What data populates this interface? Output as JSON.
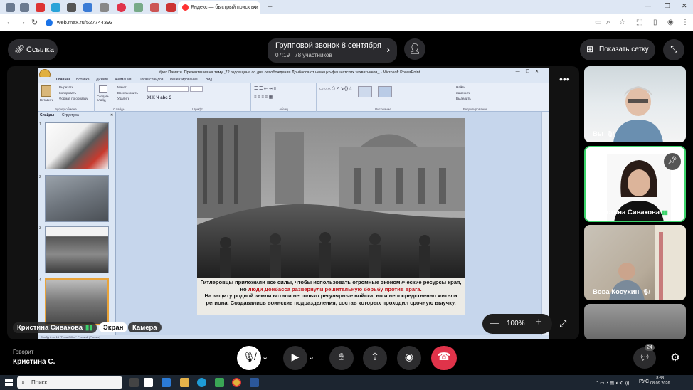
{
  "browser": {
    "active_tab_title": "Яндекс — быстрый поиск в и",
    "url": "web.max.ru/527744393",
    "tab_icons": [
      "tab-icon",
      "tab-icon",
      "tab-icon",
      "tab-icon",
      "tab-icon",
      "tab-icon",
      "tab-icon",
      "tab-icon",
      "tab-icon",
      "tab-icon",
      "tab-icon"
    ]
  },
  "call": {
    "link_label": "Ссылка",
    "title": "Групповой звонок 8 сентября",
    "duration": "07:19",
    "participants_count": "78 участников",
    "grid_label": "Показать сетку"
  },
  "powerpoint": {
    "window_title": "Урок Памяти. Презентация на тему „72 годовщина со дня освобождения Донбасса от немецко-фашистских захватчиков_ - Microsoft PowerPoint",
    "ribbon_tabs": [
      "Главная",
      "Вставка",
      "Дизайн",
      "Анимация",
      "Показ слайдов",
      "Рецензирование",
      "Вид"
    ],
    "ribbon_groups": [
      "Буфер обмена",
      "Слайды",
      "Шрифт",
      "Абзац",
      "Рисование",
      "Редактирование"
    ],
    "clipboard_items": [
      "Вырезать",
      "Копировать",
      "Формат по образцу"
    ],
    "paste_label": "Вставить",
    "slides_items": [
      "Макет",
      "Восстановить",
      "Удалить"
    ],
    "new_slide_label": "Создать слайд",
    "editing_items": [
      "Найти",
      "Заменить",
      "Выделить"
    ],
    "panel_tabs": [
      "Слайды",
      "Структура"
    ],
    "slide_numbers": [
      "1",
      "2",
      "3",
      "4"
    ],
    "caption_line1": "Гитлеровцы приложили все силы, чтобы использовать огромные экономические ресурсы края,",
    "caption_line2_pre": "но ",
    "caption_line2_red": "люди Донбасса развернули решительную борьбу против врага.",
    "caption_line3": "На защиту родной земли встали не только регулярные войска, но и непосредственно жители",
    "caption_line4": "региона. Создавались  воинские подразделения, состав которых проходил срочную выучку.",
    "status_text": "Слайд 8 из 16    \"Тема Office\"    Русский (Россия)",
    "notes_fragment": "у"
  },
  "share_overlay": {
    "presenter_name": "Кристина Сивакова",
    "screen_label": "Экран",
    "camera_label": "Камера",
    "zoom": "100%"
  },
  "participants": [
    {
      "name": "Вы"
    },
    {
      "name": "Кристина Сивакова"
    },
    {
      "name": "Вова Косухин"
    },
    {
      "name": ""
    }
  ],
  "footer": {
    "speaking_label": "Говорит",
    "speaking_name": "Кристина С.",
    "chat_count": "24"
  },
  "taskbar": {
    "search_placeholder": "Поиск",
    "lang": "РУС",
    "time": "8:38",
    "date": "08.09.2026"
  },
  "colors": {
    "hangup": "#e0334a",
    "audio_level": "#3cd36b",
    "caption_highlight": "#c0141c"
  }
}
